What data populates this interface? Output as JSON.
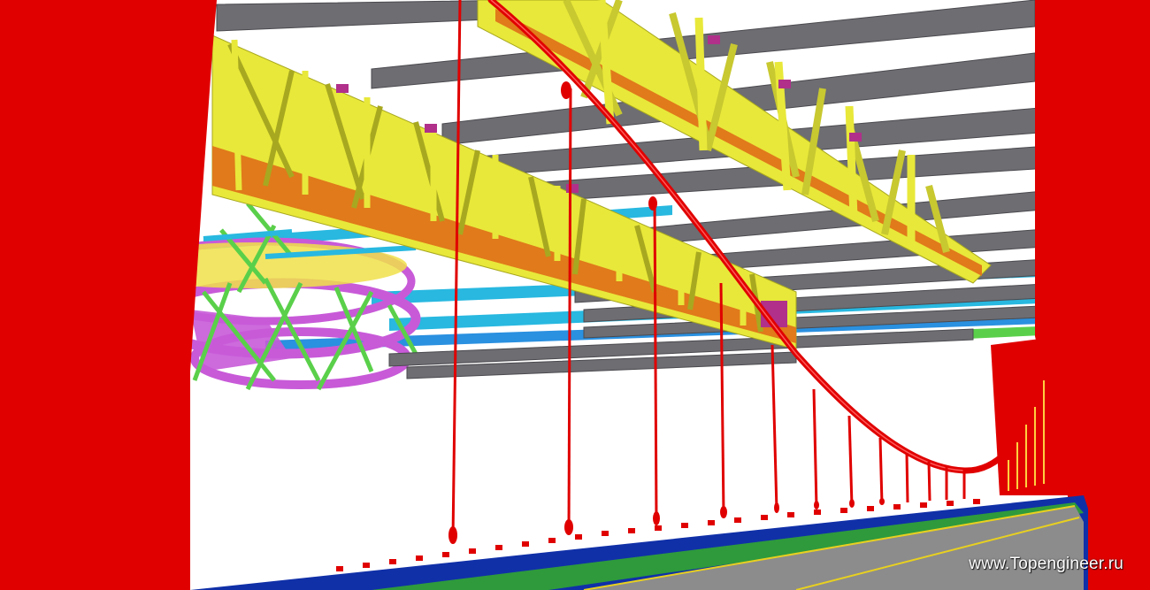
{
  "watermark": {
    "text": "www.Topengineer.ru"
  },
  "colors": {
    "pylon": "#e00000",
    "truss": "#e8e83a",
    "truss_edge": "#a8a820",
    "beam": "#6d6d72",
    "beam_edge": "#4a4a4f",
    "chord": "#e07a1a",
    "cable": "#e00000",
    "hanger": "#e00000",
    "ring": "#c85ad8",
    "bracing": "#5ad04a",
    "cyan_beam": "#28b8e0",
    "deck_blue": "#1030a8",
    "deck_green": "#2e9a3c",
    "road_gray": "#8c8c8c",
    "lane_line": "#e8d020"
  }
}
